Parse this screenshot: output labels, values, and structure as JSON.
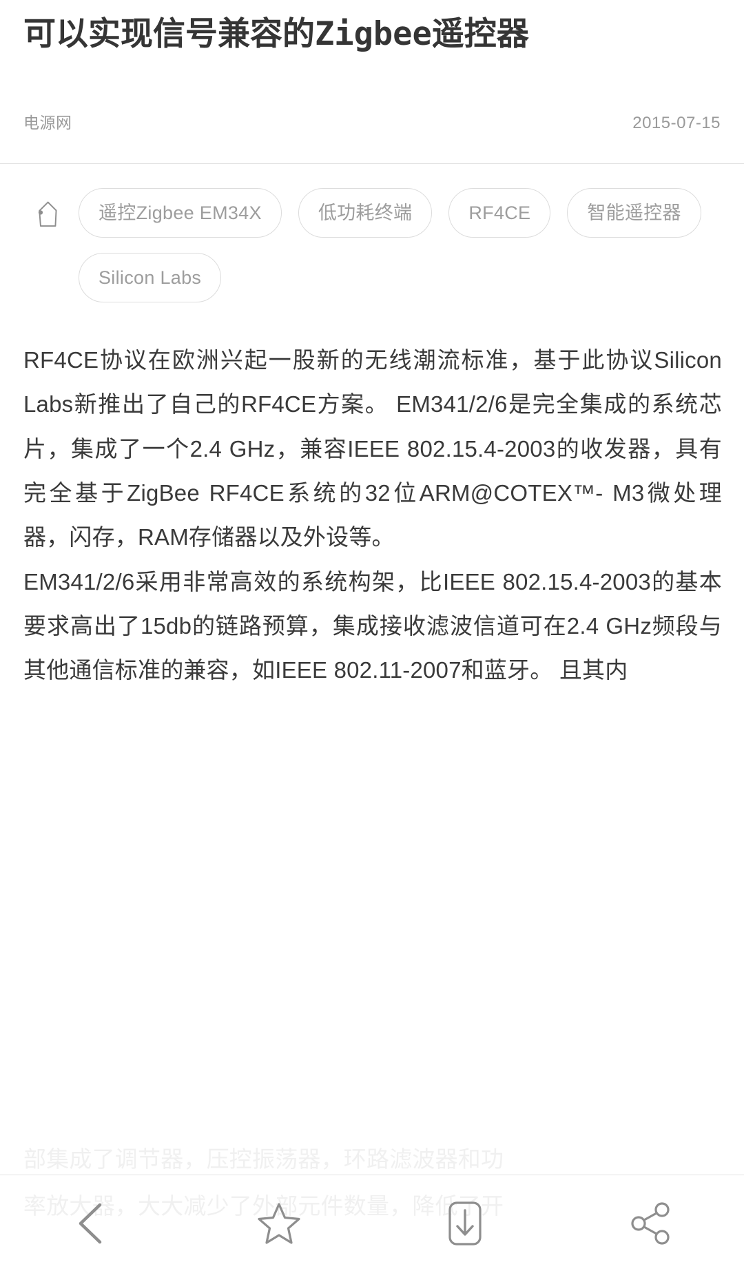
{
  "article": {
    "title": "可以实现信号兼容的Zigbee遥控器",
    "source": "电源网",
    "date": "2015-07-15",
    "tag_icon": "tag-icon",
    "tags": [
      "遥控Zigbee EM34X",
      "低功耗终端",
      "RF4CE",
      "智能遥控器",
      "Silicon Labs"
    ],
    "paragraphs": [
      "RF4CE协议在欧洲兴起一股新的无线潮流标准，基于此协议Silicon Labs新推出了自己的RF4CE方案。 EM341/2/6是完全集成的系统芯片，集成了一个2.4 GHz，兼容IEEE 802.15.4-2003的收发器，具有完全基于ZigBee RF4CE系统的32位ARM@COTEX™- M3微处理器，闪存，RAM存储器以及外设等。",
      "EM341/2/6采用非常高效的系统构架，比IEEE 802.15.4-2003的基本要求高出了15db的链路预算，集成接收滤波信道可在2.4 GHz频段与其他通信标准的兼容，如IEEE 802.11-2007和蓝牙。 且其内"
    ],
    "faded_lines": [
      "部集成了调节器，压控振荡器，环路滤波器和功",
      "率放大器，大大减少了外部元件数量，降低了开"
    ]
  },
  "toolbar": {
    "buttons": [
      {
        "name": "back-icon",
        "label": "返回"
      },
      {
        "name": "star-icon",
        "label": "收藏"
      },
      {
        "name": "download-icon",
        "label": "下载"
      },
      {
        "name": "share-icon",
        "label": "分享"
      }
    ]
  },
  "colors": {
    "background": "#ffffff",
    "title_text": "#353535",
    "body_text": "#3a3a3a",
    "muted_text": "#9a9a9a",
    "chip_border": "#dcdcdc",
    "chip_text": "#9d9d9d",
    "divider": "#e2e2e2",
    "icon_stroke": "#8e8e8e"
  }
}
